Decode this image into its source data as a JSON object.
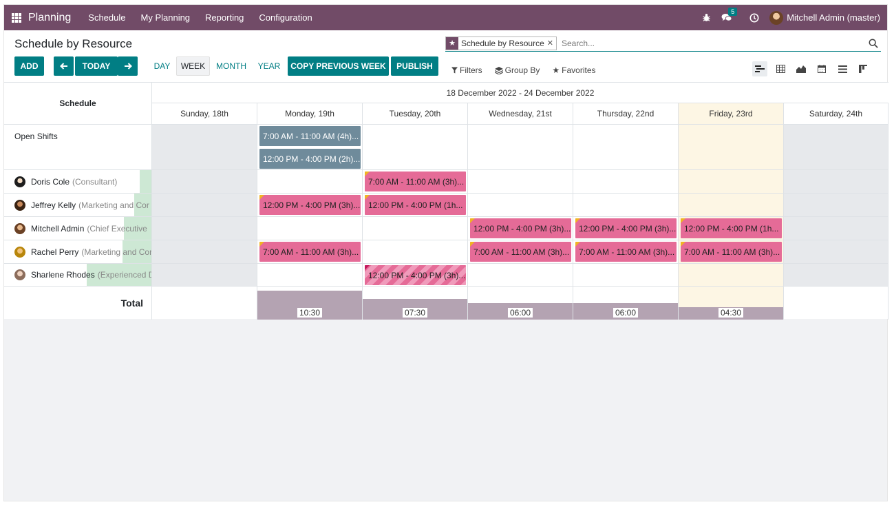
{
  "navbar": {
    "app_name": "Planning",
    "menu": [
      "Schedule",
      "My Planning",
      "Reporting",
      "Configuration"
    ],
    "messages_count": "5",
    "user": "Mitchell Admin (master)"
  },
  "control": {
    "title": "Schedule by Resource",
    "add_label": "ADD",
    "today_label": "TODAY",
    "scales": [
      "DAY",
      "WEEK",
      "MONTH",
      "YEAR"
    ],
    "active_scale": "WEEK",
    "copy_label": "COPY PREVIOUS WEEK",
    "publish_label": "PUBLISH",
    "search": {
      "facet": "Schedule by Resource",
      "placeholder": "Search..."
    },
    "filters_label": "Filters",
    "groupby_label": "Group By",
    "favorites_label": "Favorites",
    "views": [
      "gantt",
      "pivot",
      "graph",
      "calendar",
      "list",
      "kanban"
    ]
  },
  "gantt": {
    "header": "Schedule",
    "period": "18 December 2022 - 24 December 2022",
    "days": [
      "Sunday, 18th",
      "Monday, 19th",
      "Tuesday, 20th",
      "Wednesday, 21st",
      "Thursday, 22nd",
      "Friday, 23rd",
      "Saturday, 24th"
    ],
    "today_index": 5,
    "rows": [
      {
        "name": "Open Shifts",
        "role": ""
      },
      {
        "name": "Doris Cole",
        "role": "(Consultant)"
      },
      {
        "name": "Jeffrey Kelly",
        "role": "(Marketing and Cor"
      },
      {
        "name": "Mitchell Admin",
        "role": "(Chief Executive"
      },
      {
        "name": "Rachel Perry",
        "role": "(Marketing and Cor"
      },
      {
        "name": "Sharlene Rhodes",
        "role": "(Experienced D"
      }
    ],
    "shifts": [
      {
        "row": 0,
        "day": 1,
        "sub": 0,
        "label": "7:00 AM - 11:00 AM (4h)...",
        "style": "grey"
      },
      {
        "row": 0,
        "day": 1,
        "sub": 1,
        "label": "12:00 PM - 4:00 PM (2h)...",
        "style": "grey"
      },
      {
        "row": 1,
        "day": 2,
        "sub": 0,
        "label": "7:00 AM - 11:00 AM (3h)...",
        "style": "pink"
      },
      {
        "row": 2,
        "day": 1,
        "sub": 0,
        "label": "12:00 PM - 4:00 PM (3h)...",
        "style": "pink"
      },
      {
        "row": 2,
        "day": 2,
        "sub": 0,
        "label": "12:00 PM - 4:00 PM (1h...",
        "style": "pink"
      },
      {
        "row": 3,
        "day": 3,
        "sub": 0,
        "label": "12:00 PM - 4:00 PM (3h)...",
        "style": "pink"
      },
      {
        "row": 3,
        "day": 4,
        "sub": 0,
        "label": "12:00 PM - 4:00 PM (3h)...",
        "style": "pink"
      },
      {
        "row": 3,
        "day": 5,
        "sub": 0,
        "label": "12:00 PM - 4:00 PM (1h...",
        "style": "pink"
      },
      {
        "row": 4,
        "day": 1,
        "sub": 0,
        "label": "7:00 AM - 11:00 AM (3h)...",
        "style": "pink"
      },
      {
        "row": 4,
        "day": 3,
        "sub": 0,
        "label": "7:00 AM - 11:00 AM (3h)...",
        "style": "pink"
      },
      {
        "row": 4,
        "day": 4,
        "sub": 0,
        "label": "7:00 AM - 11:00 AM (3h)...",
        "style": "pink"
      },
      {
        "row": 4,
        "day": 5,
        "sub": 0,
        "label": "7:00 AM - 11:00 AM (3h)...",
        "style": "pink"
      },
      {
        "row": 5,
        "day": 2,
        "sub": 0,
        "label": "12:00 PM - 4:00 PM (3h)...",
        "style": "stripe"
      }
    ],
    "total_label": "Total",
    "totals": [
      {
        "day": 1,
        "value": "10:30",
        "hours": 10.5
      },
      {
        "day": 2,
        "value": "07:30",
        "hours": 7.5
      },
      {
        "day": 3,
        "value": "06:00",
        "hours": 6
      },
      {
        "day": 4,
        "value": "06:00",
        "hours": 6
      },
      {
        "day": 5,
        "value": "04:30",
        "hours": 4.5
      }
    ]
  }
}
